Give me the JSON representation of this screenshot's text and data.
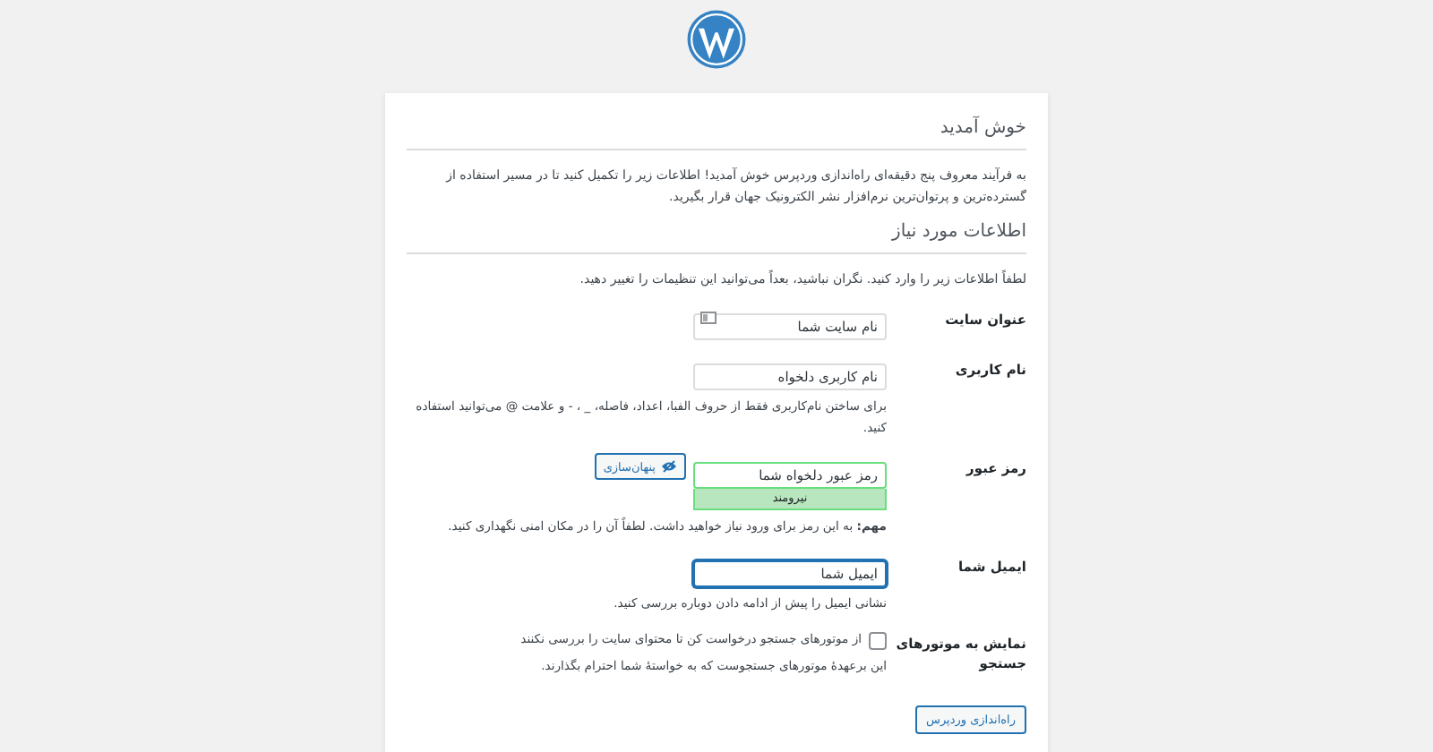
{
  "welcome": {
    "title": "خوش آمدید",
    "text": "به فرآیند معروف پنج دقیقه‌ای راه‌اندازی وردپرس خوش آمدید! اطلاعات زیر را تکمیل کنید تا در مسیر استفاده از گسترده‌ترین و پرتوان‌ترین نرم‌افزار نشر الکترونیک جهان قرار بگیرید."
  },
  "info": {
    "title": "اطلاعات مورد نیاز",
    "text": "لطفاً اطلاعات زیر را وارد کنید. نگران نباشید، بعداً می‌توانید این تنظیمات را تغییر دهید."
  },
  "fields": [
    {
      "kind": "text",
      "label": "عنوان سایت",
      "placeholder": "نام سایت شما",
      "focused": false
    },
    {
      "kind": "text",
      "label": "نام کاربری",
      "placeholder": "نام کاربری دلخواه",
      "focused": false,
      "hint": "برای ساختن نام‌کاربری فقط از حروف الفبا، اعداد، فاصله، _ ، - و علامت @ می‌توانید استفاده کنید."
    },
    {
      "kind": "password",
      "label": "رمز عبور",
      "placeholder": "رمز عبور دلخواه شما",
      "focused": false,
      "toggle": "پنهان‌سازی",
      "strength": "نیرومند",
      "hint": "**مهم:** به این رمز برای ورود نیاز خواهید داشت. لطفاً آن را در مکان امنی نگهداری کنید."
    },
    {
      "kind": "text",
      "label": "ایمیل شما",
      "placeholder": "ایمیل شما",
      "focused": true,
      "hint": "نشانی ایمیل را پیش از ادامه دادن دوباره بررسی کنید."
    },
    {
      "kind": "checkbox",
      "label": "نمایش به موتورهای جستجو",
      "checked": false,
      "option": "از موتورهای جستجو درخواست کن تا محتوای سایت را بررسی نکنند",
      "hint": "این برعهدهٔ موتورهای جستجوست که به خواستهٔ شما احترام بگذارند."
    }
  ],
  "submit": "راه‌اندازی وردپرس"
}
